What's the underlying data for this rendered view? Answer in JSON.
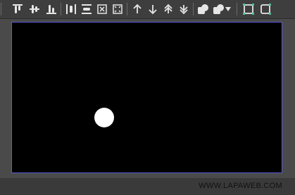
{
  "toolbar": {
    "buttons": [
      {
        "name": "align-top-icon"
      },
      {
        "name": "align-vertical-center-icon"
      },
      {
        "name": "align-bottom-icon"
      },
      {
        "name": "distribute-horizontal-icon"
      },
      {
        "name": "distribute-vertical-icon"
      },
      {
        "name": "expand-canvas-icon"
      },
      {
        "name": "fit-canvas-icon"
      },
      {
        "name": "move-up-icon"
      },
      {
        "name": "move-down-icon"
      },
      {
        "name": "bring-to-front-icon"
      },
      {
        "name": "send-to-back-icon"
      },
      {
        "name": "union-shape-icon"
      },
      {
        "name": "subtract-shape-icon"
      },
      {
        "name": "group-icon"
      },
      {
        "name": "ungroup-icon"
      }
    ],
    "icon_color": "#e6e6e6",
    "accent_color": "#4cc0a0"
  },
  "canvas": {
    "background": "#000000",
    "border_color": "#5a5ad8",
    "shape": "white-circle"
  },
  "status": {
    "watermark": "WWW.LAPAWEB.COM"
  }
}
